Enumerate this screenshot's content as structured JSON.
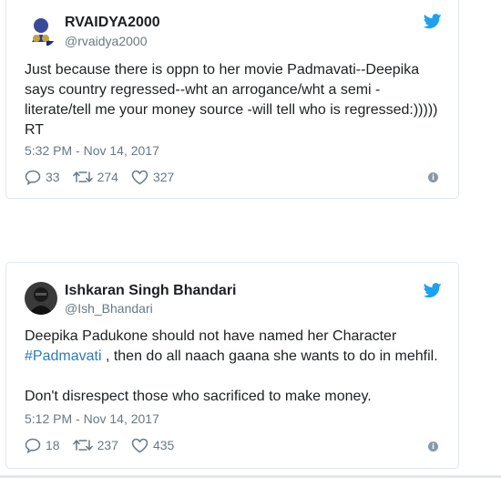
{
  "tweets": [
    {
      "name": "RVAIDYA2000",
      "handle": "@rvaidya2000",
      "text_lines": [
        "Just because there is oppn to her movie Padmavati--Deepika",
        "says country regressed--wht an arrogance/wht a semi -",
        "literate/tell me your money source -will tell who is regressed:)))))",
        "RT"
      ],
      "timestamp": "5:32 PM - Nov 14, 2017",
      "replies": "33",
      "retweets": "274",
      "likes": "327"
    },
    {
      "name": "Ishkaran Singh Bhandari",
      "handle": "@Ish_Bhandari",
      "line1": "Deepika Padukone should not have named her Character",
      "hashtag": "#Padmavati",
      "line2_rest": " , then do all naach gaana she wants to do in mehfil.",
      "line3": "Don't disrespect those who sacrificed to make money.",
      "timestamp": "5:12 PM - Nov 14, 2017",
      "replies": "18",
      "retweets": "237",
      "likes": "435"
    }
  ],
  "colors": {
    "twitter_blue": "#1da1f2",
    "hashtag": "#2b7bb9",
    "meta_gray": "#697882",
    "border": "#e1e8ed"
  },
  "icons": [
    "twitter-bird-icon",
    "reply-icon",
    "retweet-icon",
    "like-icon",
    "info-icon"
  ]
}
